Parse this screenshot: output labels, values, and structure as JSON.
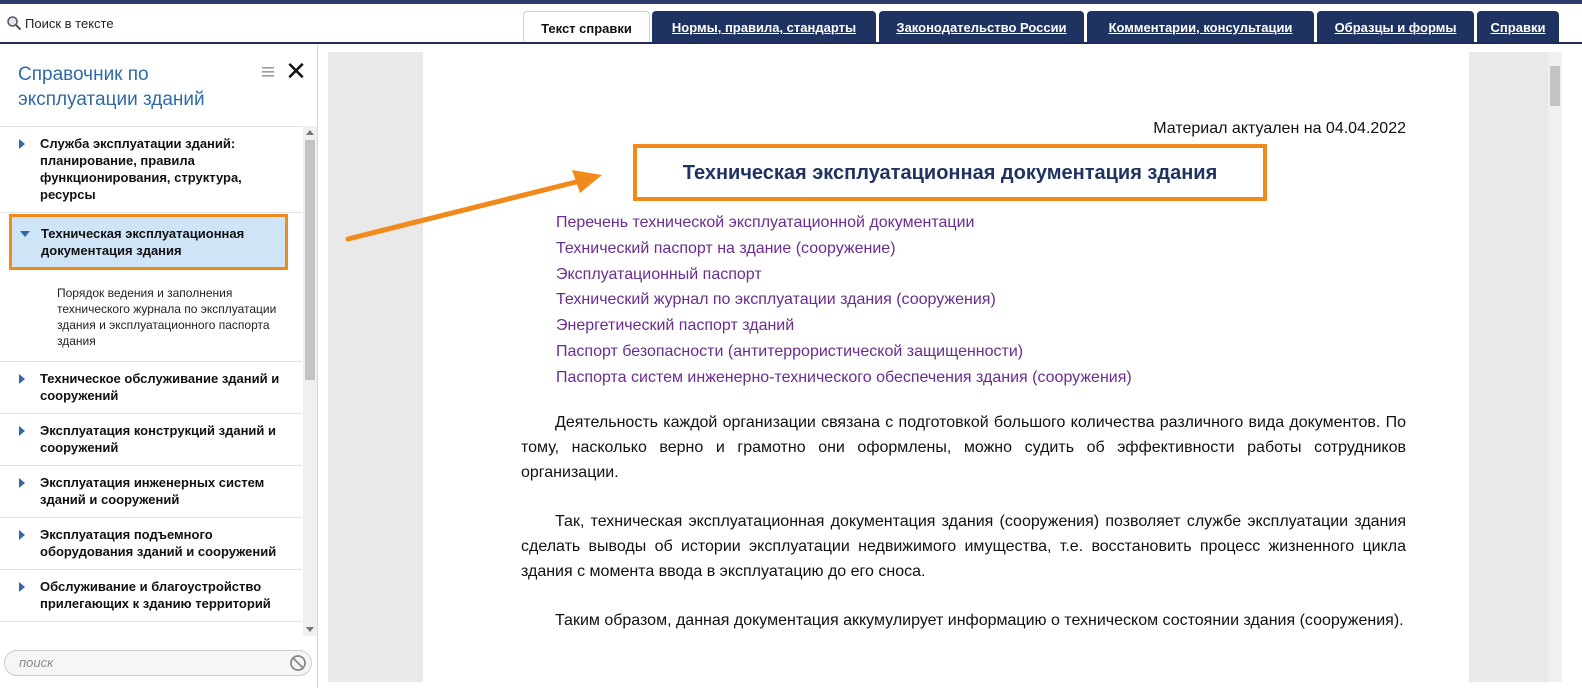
{
  "toolbar": {
    "search_label": "Поиск в тексте"
  },
  "tabs": [
    {
      "label": "Текст справки",
      "active": true
    },
    {
      "label": "Нормы, правила, стандарты",
      "active": false
    },
    {
      "label": "Законодательство России",
      "active": false
    },
    {
      "label": "Комментарии, консультации",
      "active": false
    },
    {
      "label": "Образцы и формы",
      "active": false
    },
    {
      "label": "Справки",
      "active": false
    }
  ],
  "sidebar": {
    "title": "Справочник по эксплуатации зданий",
    "items": [
      {
        "label": "Служба эксплуатации зданий: планирование, правила функционирования, структура, ресурсы"
      },
      {
        "label": "Техническая эксплуатационная документация здания",
        "active": true
      },
      {
        "label": "Порядок ведения и заполнения технического журнала по эксплуатации здания и эксплуатационного паспорта здания",
        "sub": true
      },
      {
        "label": "Техническое обслуживание зданий и сооружений"
      },
      {
        "label": "Эксплуатация конструкций зданий и сооружений"
      },
      {
        "label": "Эксплуатация инженерных систем зданий и сооружений"
      },
      {
        "label": "Эксплуатация подъемного оборудования зданий и сооружений"
      },
      {
        "label": "Обслуживание и благоустройство прилегающих к зданию территорий"
      }
    ],
    "search_placeholder": "поиск"
  },
  "document": {
    "actual_date": "Материал актуален на 04.04.2022",
    "title": "Техническая эксплуатационная документация здания",
    "toc": [
      "Перечень технической эксплуатационной документации",
      "Технический паспорт на здание (сооружение)",
      "Эксплуатационный паспорт",
      "Технический журнал по эксплуатации здания (сооружения)",
      "Энергетический паспорт зданий",
      "Паспорт безопасности (антитеррористической защищенности)",
      "Паспорта систем инженерно-технического обеспечения здания (сооружения)"
    ],
    "paragraphs": [
      "Деятельность каждой организации связана с подготовкой большого количества различного вида документов. По тому, насколько верно и грамотно они оформлены, можно судить об эффективности работы сотрудников организации.",
      "Так, техническая эксплуатационная документация здания (сооружения) позволяет службе эксплуатации здания сделать выводы об истории эксплуатации недвижимого имущества, т.е. восстановить процесс жизненного цикла здания с момента ввода в эксплуатацию до его сноса.",
      "Таким образом, данная документация аккумулирует информацию о техническом состоянии здания (сооружения)."
    ]
  },
  "colors": {
    "accent_orange": "#f28a1b",
    "tab_navy": "#1f3363",
    "link_purple": "#6a2c91",
    "title_blue": "#2f6aa6"
  }
}
